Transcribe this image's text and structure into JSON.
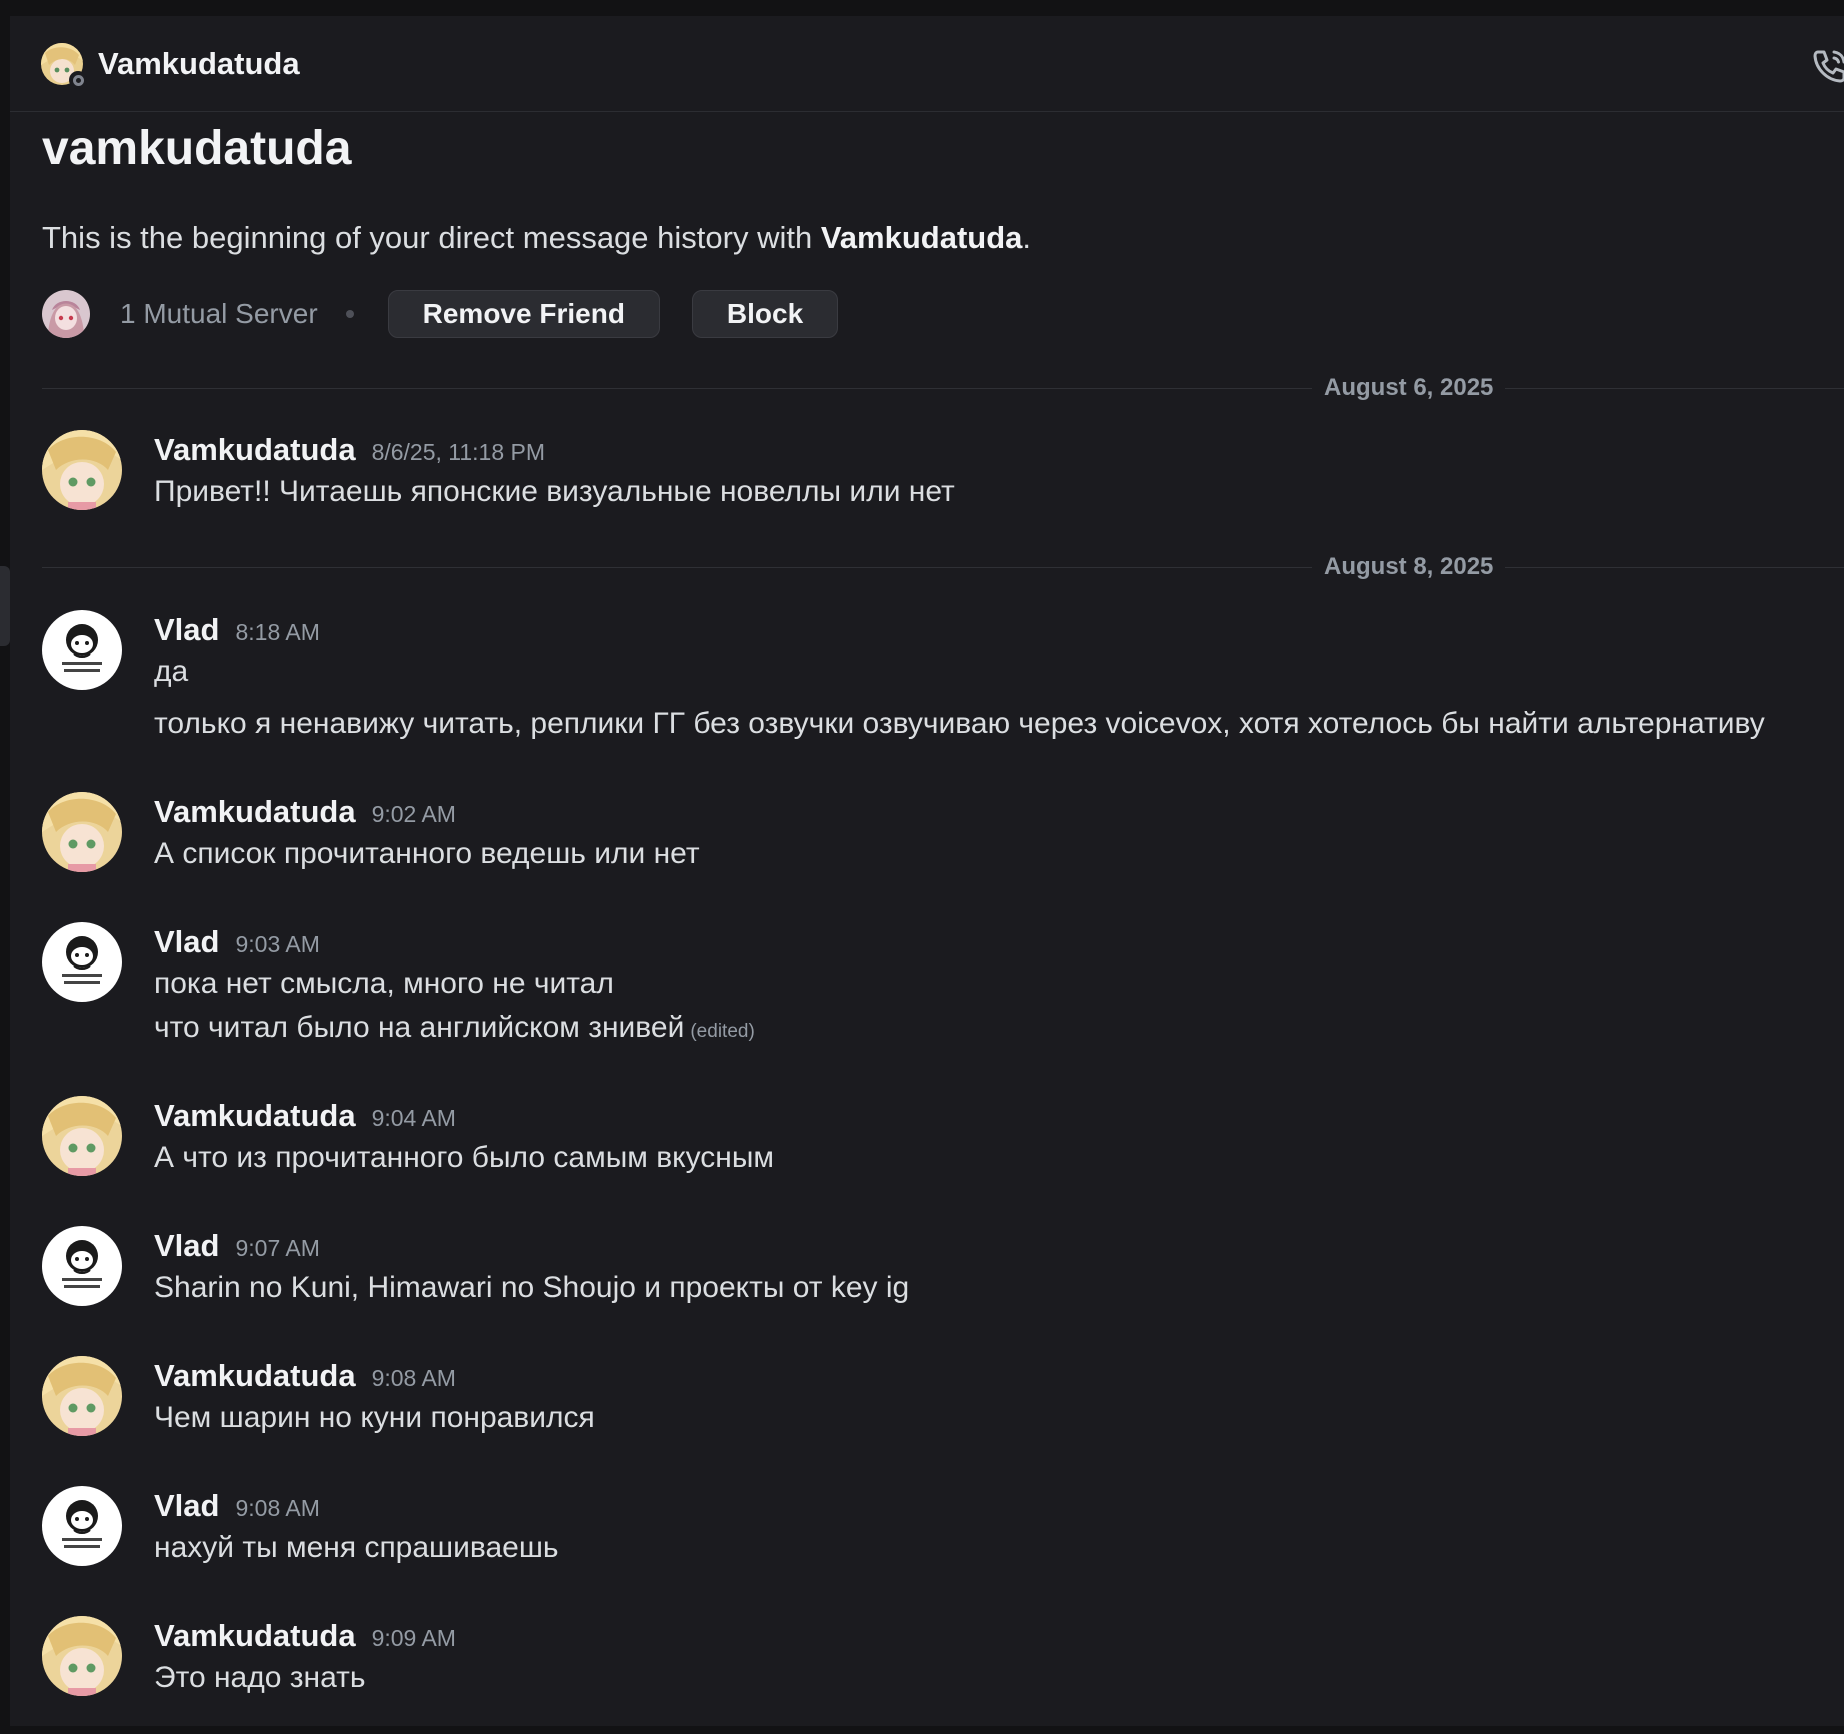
{
  "header": {
    "title": "Vamkudatuda"
  },
  "intro": {
    "title": "vamkudatuda",
    "description_prefix": "This is the beginning of your direct message history with ",
    "description_name": "Vamkudatuda",
    "description_suffix": ".",
    "mutual_servers": "1 Mutual Server",
    "remove_friend_label": "Remove Friend",
    "block_label": "Block"
  },
  "dividers": [
    {
      "label": "August 6, 2025"
    },
    {
      "label": "August 8, 2025"
    }
  ],
  "messages": [
    {
      "author": "Vamkudatuda",
      "time": "8/6/25, 11:18 PM",
      "lines": [
        "Привет!! Читаешь японские визуальные новеллы или нет"
      ]
    },
    {
      "author": "Vlad",
      "time": "8:18 AM",
      "lines": [
        "да",
        "только я ненавижу читать, реплики ГГ без озвучки озвучиваю через voicevox, хотя хотелось бы найти альтернативу"
      ]
    },
    {
      "author": "Vamkudatuda",
      "time": "9:02 AM",
      "lines": [
        "А список прочитанного ведешь или нет"
      ]
    },
    {
      "author": "Vlad",
      "time": "9:03 AM",
      "lines": [
        "пока нет смысла, много не читал",
        "что читал было на английском знивей"
      ],
      "edited": "(edited)"
    },
    {
      "author": "Vamkudatuda",
      "time": "9:04 AM",
      "lines": [
        "А что из прочитанного было самым вкусным"
      ]
    },
    {
      "author": "Vlad",
      "time": "9:07 AM",
      "lines": [
        "Sharin no Kuni, Himawari no Shoujo и проекты от key ig"
      ]
    },
    {
      "author": "Vamkudatuda",
      "time": "9:08 AM",
      "lines": [
        "Чем шарин но куни понравился"
      ]
    },
    {
      "author": "Vlad",
      "time": "9:08 AM",
      "lines": [
        "нахуй ты меня спрашиваешь"
      ]
    },
    {
      "author": "Vamkudatuda",
      "time": "9:09 AM",
      "lines": [
        "Это надо знать"
      ]
    }
  ],
  "icons": {
    "call": "phone-call-icon",
    "status": "offline-status-icon"
  },
  "colors": {
    "background": "#1b1b1f",
    "text_primary": "#f2f3f5",
    "text_muted": "#949ba4",
    "button_bg": "#2b2c31"
  }
}
